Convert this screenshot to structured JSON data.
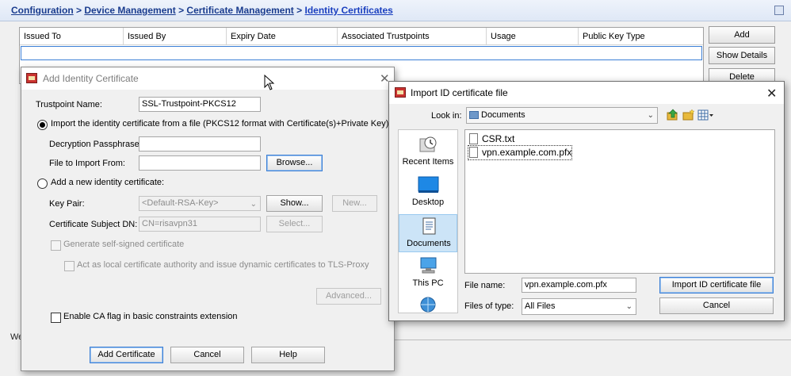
{
  "breadcrumb": {
    "items": [
      "Configuration",
      "Device Management",
      "Certificate Management",
      "Identity Certificates"
    ],
    "separator": " > "
  },
  "cert_table": {
    "columns": [
      "Issued To",
      "Issued By",
      "Expiry Date",
      "Associated Trustpoints",
      "Usage",
      "Public Key Type"
    ]
  },
  "side_buttons": {
    "add": "Add",
    "show_details": "Show Details",
    "delete": "Delete"
  },
  "background": {
    "label1": "We",
    "label2": ""
  },
  "add_dialog": {
    "title": "Add Identity Certificate",
    "trustpoint_label": "Trustpoint Name:",
    "trustpoint_value": "SSL-Trustpoint-PKCS12",
    "import_radio_label": "Import the identity certificate from a file (PKCS12 format with Certificate(s)+Private Key):",
    "import_selected": true,
    "passphrase_label": "Decryption Passphrase:",
    "passphrase_value": "",
    "file_label": "File to Import From:",
    "file_value": "",
    "browse": "Browse...",
    "new_radio_label": "Add a new identity certificate:",
    "keypair_label": "Key Pair:",
    "keypair_value": "<Default-RSA-Key>",
    "show": "Show...",
    "new": "New...",
    "subject_label": "Certificate Subject DN:",
    "subject_value": "CN=risavpn31",
    "select": "Select...",
    "self_signed_label": "Generate self-signed certificate",
    "local_ca_label": "Act as local certificate authority and issue dynamic certificates to TLS-Proxy",
    "advanced": "Advanced...",
    "ca_flag_label": "Enable CA flag in basic constraints extension",
    "add_certificate": "Add Certificate",
    "cancel": "Cancel",
    "help": "Help"
  },
  "import_dialog": {
    "title": "Import ID certificate file",
    "look_in_label": "Look in:",
    "look_in_value": "Documents",
    "places": [
      "Recent Items",
      "Desktop",
      "Documents",
      "This PC",
      ""
    ],
    "selected_place": "Documents",
    "files": [
      "CSR.txt",
      "vpn.example.com.pfx"
    ],
    "file_name_label": "File name:",
    "file_name_value": "vpn.example.com.pfx",
    "files_of_type_label": "Files of type:",
    "files_of_type_value": "All Files",
    "import_button": "Import ID certificate file",
    "cancel": "Cancel"
  },
  "icons": {
    "up_folder": "up-folder-icon",
    "new_folder": "new-folder-icon",
    "view_menu": "view-menu-icon"
  },
  "colors": {
    "breadcrumb_link": "#1a3c8e",
    "selection_blue": "#cce4f7",
    "focus_border": "#3c7fd5"
  }
}
